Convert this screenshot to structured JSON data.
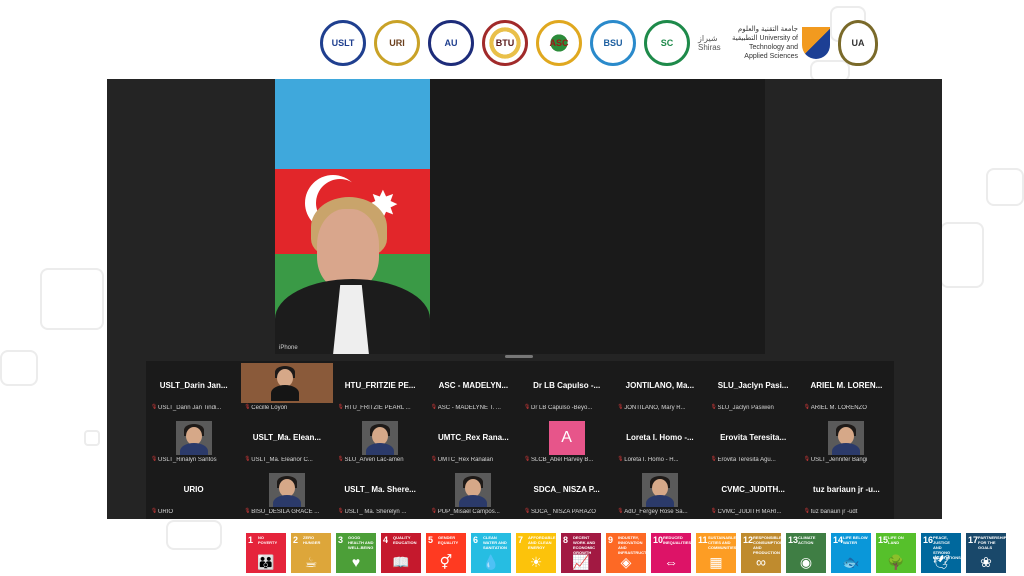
{
  "logos": {
    "l1": "USLT",
    "l2": "URI",
    "l3": "AU",
    "l4": "BTU",
    "l5": "ASC",
    "l6": "BSU",
    "l7": "SC",
    "shiras": "شيراز Shiras",
    "uta_text": "جامعة التقنية والعلوم التطبيقية University of Technology and Applied Sciences",
    "l9": "UA"
  },
  "main_video": {
    "label": "iPhone"
  },
  "gallery": [
    {
      "big": "USLT_Darin  Jan...",
      "small": "USLT_Darin Jan Tindi..."
    },
    {
      "big": "",
      "small": "Cecille Loyon",
      "video": true
    },
    {
      "big": "HTU_FRITZIE  PE...",
      "small": "HTU_FRITZIE PEARL ..."
    },
    {
      "big": "ASC - MADELYN...",
      "small": "ASC - MADELYNE T. ..."
    },
    {
      "big": "Dr LB Capulso -...",
      "small": "Dr LB Capulso -Beyo..."
    },
    {
      "big": "JONTILANO, Ma...",
      "small": "JONTILANO, Mary R..."
    },
    {
      "big": "SLU_Jaclyn  Pasi...",
      "small": "SLU_Jaclyn Pasiwen"
    },
    {
      "big": "ARIEL M. LOREN...",
      "small": "ARIEL M. LORENZO"
    },
    {
      "big": "",
      "small": "USLT_Rinalyn Santos",
      "avatar": true
    },
    {
      "big": "USLT_Ma. Elean...",
      "small": "USLT_Ma. Eleanor C..."
    },
    {
      "big": "",
      "small": "SLU_Arven Lac-amen",
      "avatar": true
    },
    {
      "big": "UMTC_Rex  Rana...",
      "small": "UMTC_Rex Ranalan"
    },
    {
      "big": "",
      "small": "SLCB_Abel Harvey B...",
      "letter": "A"
    },
    {
      "big": "Loreta I. Homo -...",
      "small": "Loreta I. Homo -  H..."
    },
    {
      "big": "Erovita  Teresita...",
      "small": "Erovita Teresita Agu..."
    },
    {
      "big": "",
      "small": "USLT_Jennifer Bangi",
      "avatar": true
    },
    {
      "big": "URIO",
      "small": "URIO"
    },
    {
      "big": "",
      "small": "BISU_DESILA GRACE ...",
      "avatar": true
    },
    {
      "big": "USLT_ Ma. Shere...",
      "small": "USLT_ Ma. Sherelyn ..."
    },
    {
      "big": "",
      "small": "PUP_Misael Campos...",
      "avatar": true
    },
    {
      "big": "SDCA_  NISZA  P...",
      "small": "SDCA_ NISZA PARAZO"
    },
    {
      "big": "",
      "small": "AdU_Fergey Rose Sa...",
      "avatar": true
    },
    {
      "big": "CVMC_JUDITH...",
      "small": "CVMC_JUDITH MARI..."
    },
    {
      "big": "tuz  bariaun jr -u...",
      "small": "tuz bariaun jr -udt"
    }
  ],
  "sdgs": [
    {
      "num": "1",
      "title": "NO POVERTY",
      "color": "#e5243b",
      "icon": "👪"
    },
    {
      "num": "2",
      "title": "ZERO HUNGER",
      "color": "#dda63a",
      "icon": "☕"
    },
    {
      "num": "3",
      "title": "GOOD HEALTH AND WELL-BEING",
      "color": "#4c9f38",
      "icon": "♥"
    },
    {
      "num": "4",
      "title": "QUALITY EDUCATION",
      "color": "#c5192d",
      "icon": "📖"
    },
    {
      "num": "5",
      "title": "GENDER EQUALITY",
      "color": "#ff3a21",
      "icon": "⚥"
    },
    {
      "num": "6",
      "title": "CLEAN WATER AND SANITATION",
      "color": "#26bde2",
      "icon": "💧"
    },
    {
      "num": "7",
      "title": "AFFORDABLE AND CLEAN ENERGY",
      "color": "#fcc30b",
      "icon": "☀"
    },
    {
      "num": "8",
      "title": "DECENT WORK AND ECONOMIC GROWTH",
      "color": "#a21942",
      "icon": "📈"
    },
    {
      "num": "9",
      "title": "INDUSTRY, INNOVATION AND INFRASTRUCTURE",
      "color": "#fd6925",
      "icon": "◈"
    },
    {
      "num": "10",
      "title": "REDUCED INEQUALITIES",
      "color": "#dd1367",
      "icon": "⇔"
    },
    {
      "num": "11",
      "title": "SUSTAINABLE CITIES AND COMMUNITIES",
      "color": "#fd9d24",
      "icon": "▦"
    },
    {
      "num": "12",
      "title": "RESPONSIBLE CONSUMPTION AND PRODUCTION",
      "color": "#bf8b2e",
      "icon": "∞"
    },
    {
      "num": "13",
      "title": "CLIMATE ACTION",
      "color": "#3f7e44",
      "icon": "◉"
    },
    {
      "num": "14",
      "title": "LIFE BELOW WATER",
      "color": "#0a97d9",
      "icon": "🐟"
    },
    {
      "num": "15",
      "title": "LIFE ON LAND",
      "color": "#56c02b",
      "icon": "🌳"
    },
    {
      "num": "16",
      "title": "PEACE, JUSTICE AND STRONG INSTITUTIONS",
      "color": "#00689d",
      "icon": "🕊"
    },
    {
      "num": "17",
      "title": "PARTNERSHIPS FOR THE GOALS",
      "color": "#19486a",
      "icon": "❀"
    }
  ]
}
